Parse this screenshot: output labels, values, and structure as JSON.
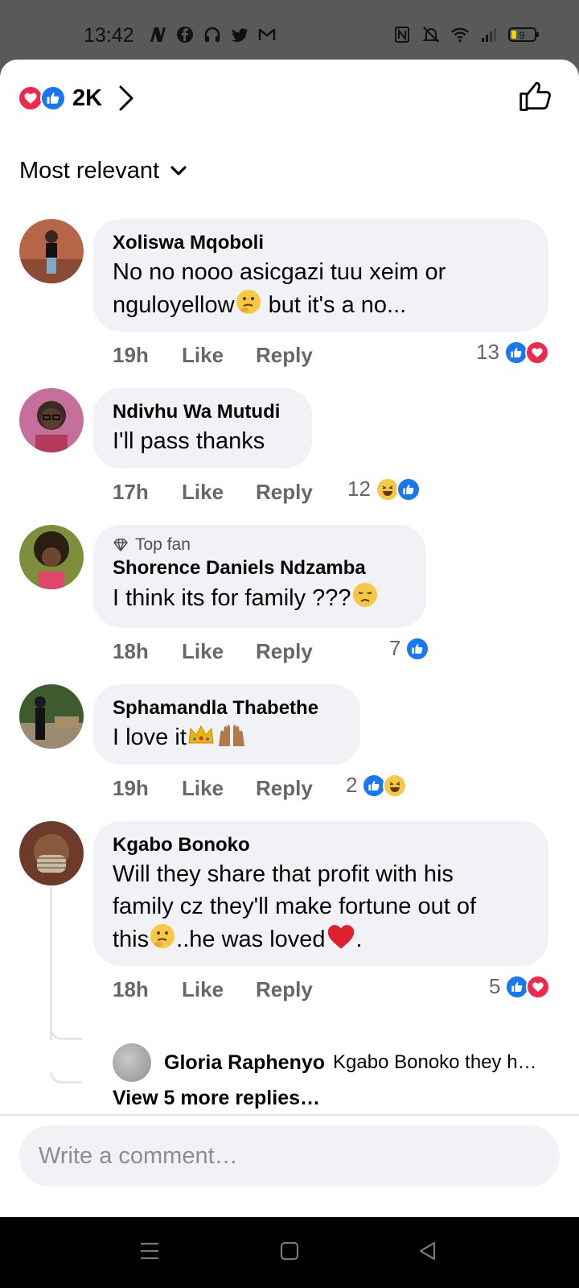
{
  "status_bar": {
    "time": "13:42",
    "battery": "9",
    "left_icons": [
      "n-icon",
      "facebook-icon",
      "headphones-icon",
      "twitter-icon",
      "gmail-icon"
    ],
    "right_icons": [
      "nfc-icon",
      "mute-icon",
      "wifi-icon",
      "signal-icon",
      "battery-icon"
    ]
  },
  "header": {
    "reaction_count": "2K"
  },
  "sort": {
    "label": "Most relevant"
  },
  "comments": [
    {
      "author": "Xoliswa Mqoboli",
      "text_line1": "No no nooo asicgazi tuu xeim or",
      "text_line2a": "nguloyellow",
      "text_line2b": " but it's a no...",
      "time": "19h",
      "like": "Like",
      "reply": "Reply",
      "reaction_count": "13",
      "reactions": [
        "like",
        "love"
      ]
    },
    {
      "author": "Ndivhu Wa Mutudi",
      "text": "I'll pass thanks",
      "time": "17h",
      "like": "Like",
      "reply": "Reply",
      "reaction_count": "12",
      "reactions": [
        "haha",
        "like"
      ]
    },
    {
      "badge": "Top fan",
      "author": "Shorence Daniels Ndzamba",
      "text": "I think its for family ???",
      "time": "18h",
      "like": "Like",
      "reply": "Reply",
      "reaction_count": "7",
      "reactions": [
        "like"
      ]
    },
    {
      "author": "Sphamandla Thabethe",
      "text": "I love it",
      "time": "19h",
      "like": "Like",
      "reply": "Reply",
      "reaction_count": "2",
      "reactions": [
        "like",
        "haha"
      ]
    },
    {
      "author": "Kgabo Bonoko",
      "text_line1": "Will they share that profit with his",
      "text_line2": "family cz they'll make fortune out of",
      "text_line3a": "this",
      "text_line3b": "..he was loved",
      "text_line3c": ".",
      "time": "18h",
      "like": "Like",
      "reply": "Reply",
      "reaction_count": "5",
      "reactions": [
        "like",
        "love"
      ]
    }
  ],
  "reply_preview": {
    "author": "Gloria Raphenyo",
    "text": "Kgabo Bonoko  they h…"
  },
  "view_more": "View 5 more replies…",
  "composer": {
    "placeholder": "Write a comment…"
  },
  "colors": {
    "like_blue": "#1877f2",
    "love_red": "#f0284a",
    "bubble_gray": "#f0f2f5",
    "meta_gray": "#65676b"
  }
}
